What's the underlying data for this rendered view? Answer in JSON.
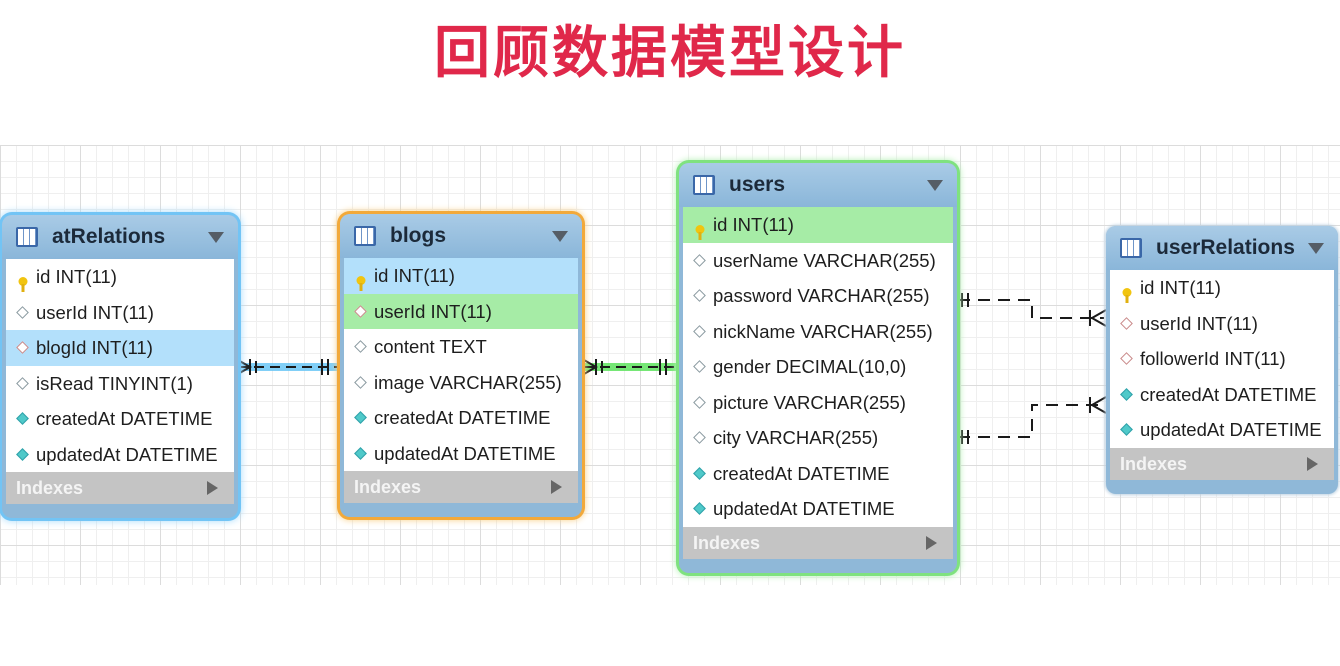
{
  "title": "回顾数据模型设计",
  "colors": {
    "title": "#e0284a",
    "table_body": "#8fb8d8",
    "highlight_blue": "#b3e0fb",
    "highlight_green": "#a6eca6",
    "outline_blue": "#72c4f5",
    "outline_orange": "#f2a93a",
    "outline_green": "#7fe27f"
  },
  "tables": {
    "atRelations": {
      "name": "atRelations",
      "columns": [
        "id INT(11)",
        "userId INT(11)",
        "blogId INT(11)",
        "isRead TINYINT(1)",
        "createdAt DATETIME",
        "updatedAt DATETIME"
      ],
      "indexes_label": "Indexes"
    },
    "blogs": {
      "name": "blogs",
      "columns": [
        "id INT(11)",
        "userId INT(11)",
        "content TEXT",
        "image VARCHAR(255)",
        "createdAt DATETIME",
        "updatedAt DATETIME"
      ],
      "indexes_label": "Indexes"
    },
    "users": {
      "name": "users",
      "columns": [
        "id INT(11)",
        "userName VARCHAR(255)",
        "password VARCHAR(255)",
        "nickName VARCHAR(255)",
        "gender DECIMAL(10,0)",
        "picture VARCHAR(255)",
        "city VARCHAR(255)",
        "createdAt DATETIME",
        "updatedAt DATETIME"
      ],
      "indexes_label": "Indexes"
    },
    "userRelations": {
      "name": "userRelations",
      "columns": [
        "id INT(11)",
        "userId INT(11)",
        "followerId INT(11)",
        "createdAt DATETIME",
        "updatedAt DATETIME"
      ],
      "indexes_label": "Indexes"
    }
  }
}
